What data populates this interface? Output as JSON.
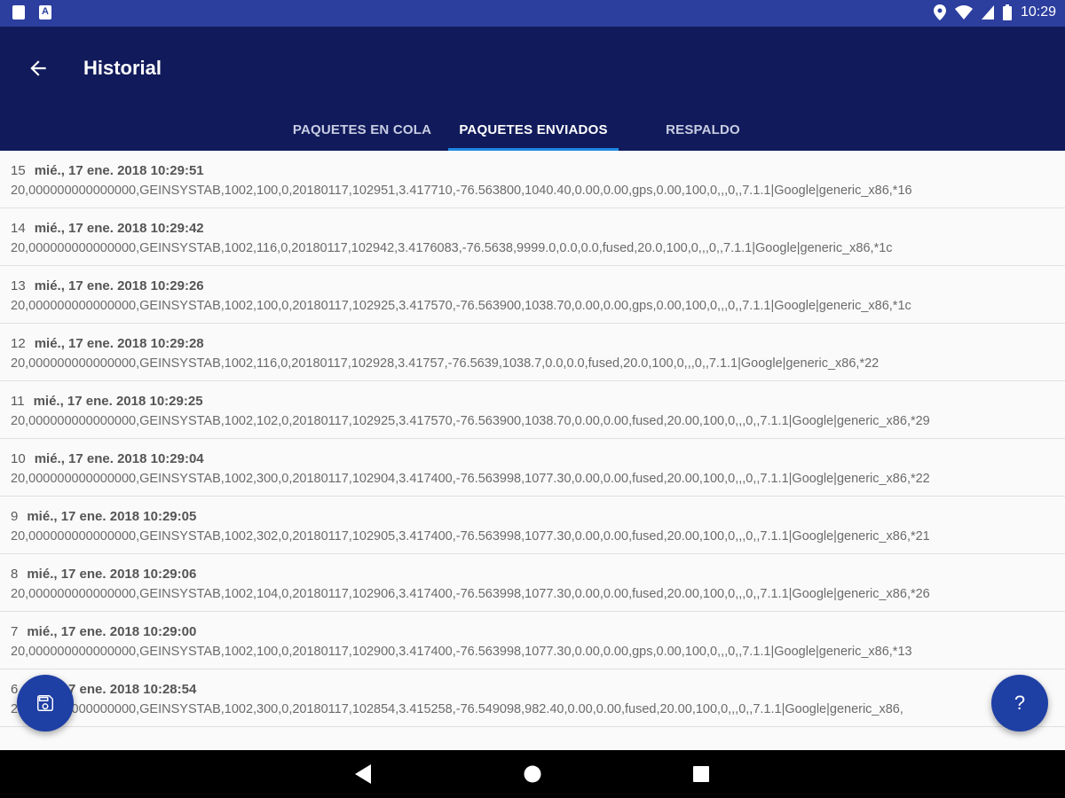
{
  "status_bar": {
    "time": "10:29",
    "left_icons": [
      "clipboard-icon",
      "a-icon"
    ],
    "a_icon_letter": "A",
    "right_icons": [
      "location-icon",
      "wifi-icon",
      "signal-icon",
      "battery-icon"
    ]
  },
  "app_bar": {
    "title": "Historial",
    "back_icon": "arrow-back-icon",
    "background": "#111b5b"
  },
  "tabs": [
    {
      "label": "PAQUETES EN COLA",
      "active": false
    },
    {
      "label": "PAQUETES ENVIADOS",
      "active": true
    },
    {
      "label": "RESPALDO",
      "active": false
    }
  ],
  "entries": [
    {
      "num": "15",
      "date": "mié., 17 ene. 2018 10:29:51",
      "data": "20,000000000000000,GEINSYSTAB,1002,100,0,20180117,102951,3.417710,-76.563800,1040.40,0.00,0.00,gps,0.00,100,0,,,0,,7.1.1|Google|generic_x86,*16"
    },
    {
      "num": "14",
      "date": "mié., 17 ene. 2018 10:29:42",
      "data": "20,000000000000000,GEINSYSTAB,1002,116,0,20180117,102942,3.4176083,-76.5638,9999.0,0.0,0.0,fused,20.0,100,0,,,0,,7.1.1|Google|generic_x86,*1c"
    },
    {
      "num": "13",
      "date": "mié., 17 ene. 2018 10:29:26",
      "data": "20,000000000000000,GEINSYSTAB,1002,100,0,20180117,102925,3.417570,-76.563900,1038.70,0.00,0.00,gps,0.00,100,0,,,0,,7.1.1|Google|generic_x86,*1c"
    },
    {
      "num": "12",
      "date": "mié., 17 ene. 2018 10:29:28",
      "data": "20,000000000000000,GEINSYSTAB,1002,116,0,20180117,102928,3.41757,-76.5639,1038.7,0.0,0.0,fused,20.0,100,0,,,0,,7.1.1|Google|generic_x86,*22"
    },
    {
      "num": "11",
      "date": "mié., 17 ene. 2018 10:29:25",
      "data": "20,000000000000000,GEINSYSTAB,1002,102,0,20180117,102925,3.417570,-76.563900,1038.70,0.00,0.00,fused,20.00,100,0,,,0,,7.1.1|Google|generic_x86,*29"
    },
    {
      "num": "10",
      "date": "mié., 17 ene. 2018 10:29:04",
      "data": "20,000000000000000,GEINSYSTAB,1002,300,0,20180117,102904,3.417400,-76.563998,1077.30,0.00,0.00,fused,20.00,100,0,,,0,,7.1.1|Google|generic_x86,*22"
    },
    {
      "num": "9",
      "date": "mié., 17 ene. 2018 10:29:05",
      "data": "20,000000000000000,GEINSYSTAB,1002,302,0,20180117,102905,3.417400,-76.563998,1077.30,0.00,0.00,fused,20.00,100,0,,,0,,7.1.1|Google|generic_x86,*21"
    },
    {
      "num": "8",
      "date": "mié., 17 ene. 2018 10:29:06",
      "data": "20,000000000000000,GEINSYSTAB,1002,104,0,20180117,102906,3.417400,-76.563998,1077.30,0.00,0.00,fused,20.00,100,0,,,0,,7.1.1|Google|generic_x86,*26"
    },
    {
      "num": "7",
      "date": "mié., 17 ene. 2018 10:29:00",
      "data": "20,000000000000000,GEINSYSTAB,1002,100,0,20180117,102900,3.417400,-76.563998,1077.30,0.00,0.00,gps,0.00,100,0,,,0,,7.1.1|Google|generic_x86,*13"
    },
    {
      "num": "6",
      "date": "mié., 17 ene. 2018 10:28:54",
      "data": "20,000000000000000,GEINSYSTAB,1002,300,0,20180117,102854,3.415258,-76.549098,982.40,0.00,0.00,fused,20.00,100,0,,,0,,7.1.1|Google|generic_x86,"
    }
  ],
  "fabs": {
    "save_icon": "save-icon",
    "help_label": "?"
  },
  "nav_bar": {
    "icons": [
      "back-triangle-icon",
      "home-circle-icon",
      "recents-square-icon"
    ]
  },
  "colors": {
    "status_bar": "#2c3e9e",
    "app_bar": "#111b5b",
    "tab_indicator": "#1e88e5",
    "fab": "#1e3fa4"
  }
}
